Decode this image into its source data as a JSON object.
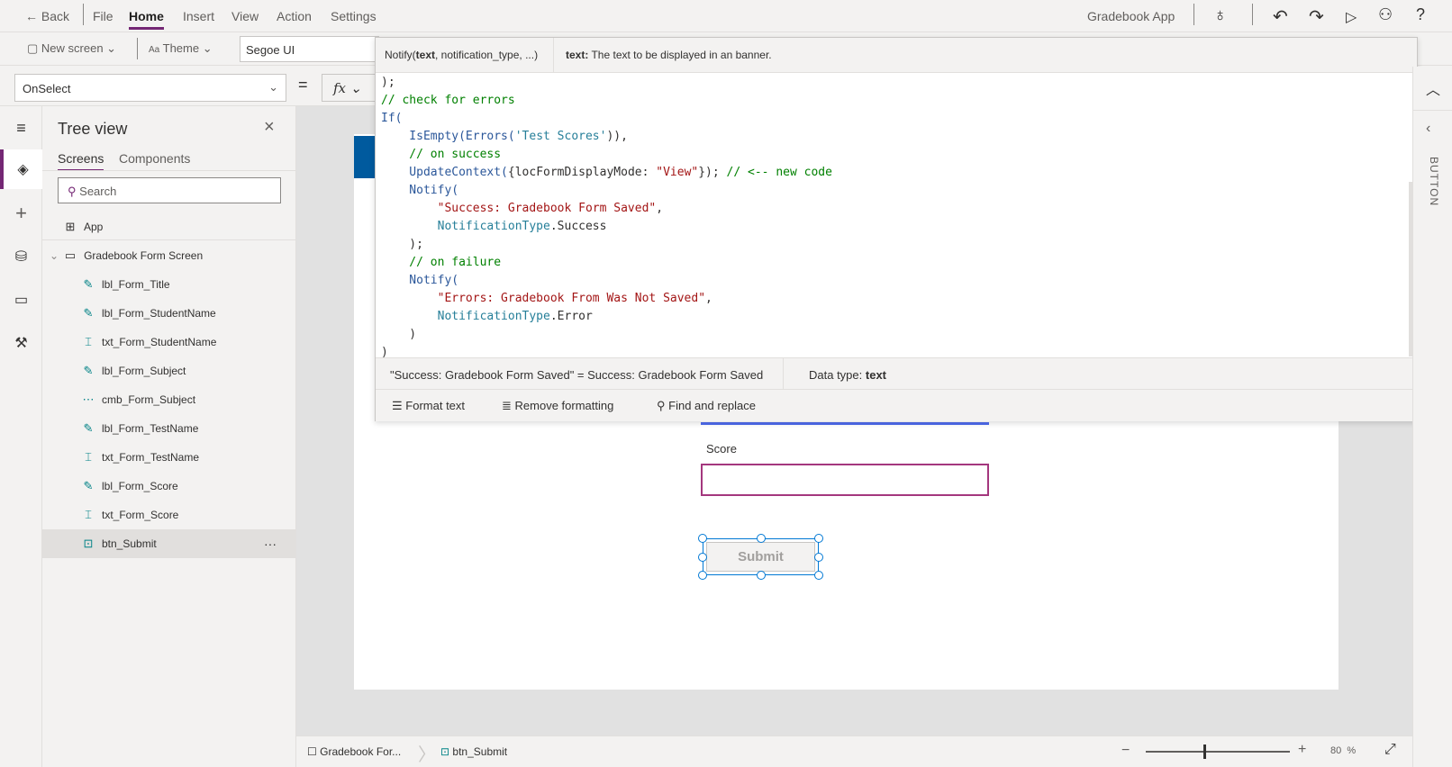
{
  "topbar": {
    "back": "Back",
    "menus": [
      "File",
      "Home",
      "Insert",
      "View",
      "Action",
      "Settings"
    ],
    "active_menu": "Home",
    "app_name": "Gradebook App",
    "icons": [
      "stethoscope-icon",
      "undo-icon",
      "redo-icon",
      "play-icon",
      "share-user-icon",
      "help-icon"
    ]
  },
  "ribbon": {
    "new_screen": "New screen",
    "theme": "Theme",
    "font": "Segoe UI"
  },
  "formula_bar": {
    "property": "OnSelect",
    "eq": "=",
    "fx": "fx"
  },
  "popup": {
    "signature_prefix": "Notify(",
    "signature_bold": "text",
    "signature_rest": ", notification_type, ...)",
    "param_name": "text:",
    "param_desc": "The text to be displayed in an banner.",
    "code": [
      [
        {
          "t": ");",
          "c": "pl"
        }
      ],
      [
        {
          "t": "// check for errors",
          "c": "cm"
        }
      ],
      [
        {
          "t": "If(",
          "c": "kw"
        }
      ],
      [
        {
          "t": "    IsEmpty(",
          "c": "fn"
        },
        {
          "t": "Errors(",
          "c": "fn"
        },
        {
          "t": "'Test Scores'",
          "c": "ty"
        },
        {
          "t": ")),",
          "c": "pl"
        }
      ],
      [
        {
          "t": "    // on success",
          "c": "cm"
        }
      ],
      [
        {
          "t": "    UpdateContext(",
          "c": "fn"
        },
        {
          "t": "{locFormDisplayMode: ",
          "c": "pl"
        },
        {
          "t": "\"View\"",
          "c": "st"
        },
        {
          "t": "}); ",
          "c": "pl"
        },
        {
          "t": "// <-- new code",
          "c": "cm"
        }
      ],
      [
        {
          "t": "    Notify(",
          "c": "fn"
        }
      ],
      [
        {
          "t": "        \"Success: Gradebook Form Saved\"",
          "c": "st"
        },
        {
          "t": ",",
          "c": "pl"
        }
      ],
      [
        {
          "t": "        NotificationType",
          "c": "ty"
        },
        {
          "t": ".Success",
          "c": "pl"
        }
      ],
      [
        {
          "t": "    );",
          "c": "pl"
        }
      ],
      [
        {
          "t": "    // on failure",
          "c": "cm"
        }
      ],
      [
        {
          "t": "    Notify(",
          "c": "fn"
        }
      ],
      [
        {
          "t": "        \"Errors: Gradebook From Was Not Saved\"",
          "c": "st"
        },
        {
          "t": ",",
          "c": "pl"
        }
      ],
      [
        {
          "t": "        NotificationType",
          "c": "ty"
        },
        {
          "t": ".Error",
          "c": "pl"
        }
      ],
      [
        {
          "t": "    )",
          "c": "pl"
        }
      ],
      [
        {
          "t": ")",
          "c": "pl"
        }
      ]
    ],
    "result": "\"Success: Gradebook Form Saved\"  =  Success: Gradebook Form Saved",
    "data_type_label": "Data type:",
    "data_type": "text",
    "format_text": "Format text",
    "remove_formatting": "Remove formatting",
    "find_replace": "Find and replace"
  },
  "tree": {
    "title": "Tree view",
    "tabs": [
      "Screens",
      "Components"
    ],
    "active_tab": "Screens",
    "search_placeholder": "Search",
    "app": "App",
    "screen": "Gradebook Form Screen",
    "items": [
      {
        "label": "lbl_Form_Title",
        "icon": "label-icon"
      },
      {
        "label": "lbl_Form_StudentName",
        "icon": "label-icon"
      },
      {
        "label": "txt_Form_StudentName",
        "icon": "text-input-icon"
      },
      {
        "label": "lbl_Form_Subject",
        "icon": "label-icon"
      },
      {
        "label": "cmb_Form_Subject",
        "icon": "combobox-icon"
      },
      {
        "label": "lbl_Form_TestName",
        "icon": "label-icon"
      },
      {
        "label": "txt_Form_TestName",
        "icon": "text-input-icon"
      },
      {
        "label": "lbl_Form_Score",
        "icon": "label-icon"
      },
      {
        "label": "txt_Form_Score",
        "icon": "text-input-icon"
      },
      {
        "label": "btn_Submit",
        "icon": "button-icon",
        "selected": true
      }
    ],
    "more": "···"
  },
  "canvas": {
    "score_label": "Score",
    "submit": "Submit"
  },
  "bottombar": {
    "screen_crumb": "Gradebook For...",
    "control_crumb": "btn_Submit",
    "zoom": "80",
    "zoom_unit": "%",
    "zoom_fraction": 0.4
  },
  "right_panel": {
    "label": "BUTTON"
  },
  "colors": {
    "accent": "#742774",
    "selection": "#0078d4",
    "input_border": "#a4377e"
  }
}
